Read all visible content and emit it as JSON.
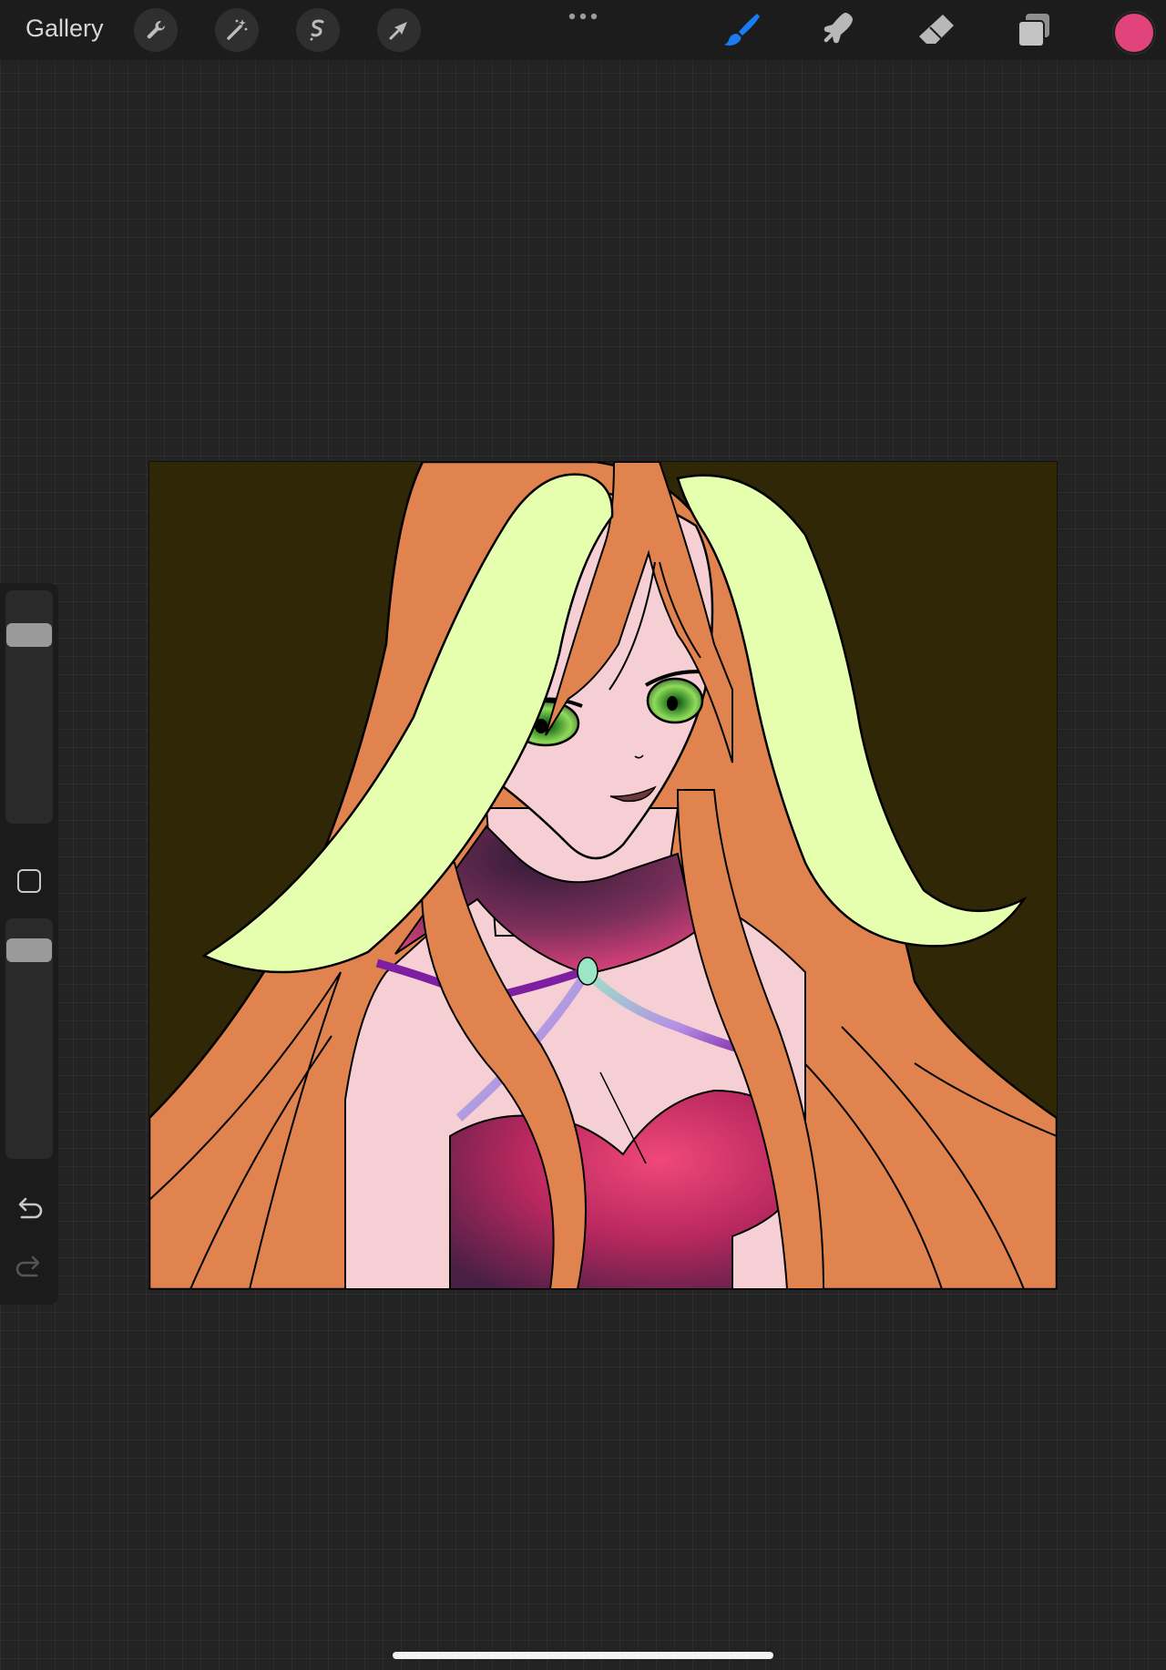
{
  "app": {
    "gallery_label": "Gallery"
  },
  "toolbar": {
    "left_tools": [
      "wrench-icon",
      "magic-wand-icon",
      "selection-icon",
      "transform-arrow-icon"
    ],
    "more_menu": "more-dots-icon",
    "right_tools": [
      "brush-icon",
      "smudge-icon",
      "eraser-icon",
      "layers-icon"
    ],
    "active_tool": "brush-icon",
    "current_color": "#e0447a",
    "active_tool_color": "#1a7cf5"
  },
  "sidebar": {
    "brush_size_level": 0.92,
    "opacity_level": 0.96,
    "undo_icon": "undo-icon",
    "redo_icon": "redo-icon"
  },
  "canvas": {
    "background_color": "#302707",
    "hair_color": "#e0834f",
    "ear_color": "#e6ffae",
    "skin_color": "#f5cfd3",
    "outfit_color": "#c2375e"
  }
}
